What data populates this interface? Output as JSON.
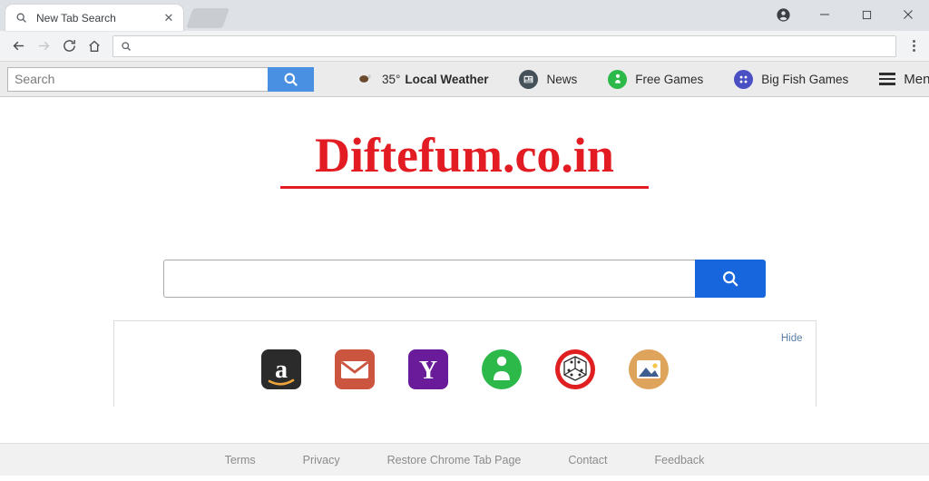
{
  "window": {
    "controls": [
      {
        "name": "profile",
        "glyph": "account-circle-icon"
      },
      {
        "name": "minimize",
        "glyph": "–"
      },
      {
        "name": "maximize",
        "glyph": "□"
      },
      {
        "name": "close",
        "glyph": "✕"
      }
    ]
  },
  "tab": {
    "title": "New Tab Search",
    "close_glyph": "✕",
    "favicon": "search-icon"
  },
  "omnibox": {
    "value": "",
    "icon": "search-icon"
  },
  "nav": {
    "back": "←",
    "forward": "→",
    "reload": "⟳",
    "home": "⌂"
  },
  "ext_toolbar": {
    "search_placeholder": "Search",
    "search_value": "",
    "search_button_icon": "search-icon",
    "links": [
      {
        "label": "Local Weather",
        "temp": "35°",
        "icon": "coffee-cup-icon",
        "color": "#7a5c3e"
      },
      {
        "label": "News",
        "icon": "newspaper-icon",
        "color": "#3b4a52"
      },
      {
        "label": "Free Games",
        "icon": "pawn-person-icon",
        "color": "#2db84a"
      },
      {
        "label": "Big Fish Games",
        "icon": "big-fish-games-icon",
        "color": "#4b4fc4"
      }
    ],
    "menu_label": "Menu",
    "menu_icon": "hamburger-icon"
  },
  "page": {
    "title": "Diftefum.co.in",
    "title_color": "#e31c23",
    "search": {
      "value": "",
      "placeholder": "",
      "button_icon": "search-icon",
      "button_color": "#1766dd"
    },
    "shortcuts_panel": {
      "hide_label": "Hide",
      "items": [
        {
          "name": "amazon",
          "label": "Amazon",
          "color": "#2b2b2b"
        },
        {
          "name": "email",
          "label": "Email",
          "color": "#cc5540"
        },
        {
          "name": "yahoo",
          "label": "Yahoo",
          "color": "#6a1b9a"
        },
        {
          "name": "free-games",
          "label": "Free Games",
          "color": "#2db84a"
        },
        {
          "name": "dice-games",
          "label": "Games",
          "color": "#e02020"
        },
        {
          "name": "images",
          "label": "Images",
          "color": "#dfa45c"
        }
      ]
    },
    "footer_links": [
      {
        "label": "Terms"
      },
      {
        "label": "Privacy"
      },
      {
        "label": "Restore Chrome Tab Page"
      },
      {
        "label": "Contact"
      },
      {
        "label": "Feedback"
      }
    ]
  }
}
